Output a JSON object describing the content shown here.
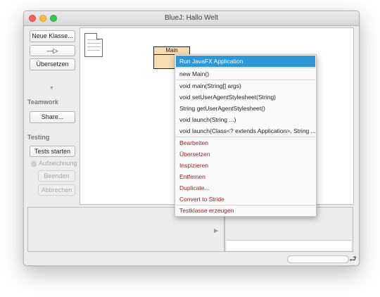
{
  "window": {
    "title": "BlueJ:  Hallo Welt"
  },
  "sidebar": {
    "new_class_label": "Neue Klasse...",
    "arrow_glyph": "—▷",
    "compile_label": "Übersetzen",
    "teamwork_label": "Teamwork",
    "share_label": "Share...",
    "testing_label": "Testing",
    "run_tests_label": "Tests starten",
    "record_label": "Aufzeichnung",
    "end_label": "Beenden",
    "cancel_label": "Abbrechen",
    "collapse_glyph": "▼"
  },
  "class_diagram": {
    "class_name": "Main"
  },
  "context_menu": {
    "items": [
      "Run JavaFX Application",
      "new Main()",
      "void main(String[] args)",
      "void setUserAgentStylesheet(String)",
      "String getUserAgentStylesheet()",
      "void launch(String ...)",
      "void launch(Class<? extends Application>, String ...)",
      "Bearbeiten",
      "Übersetzen",
      "Inspizieren",
      "Entfernen",
      "Duplicate...",
      "Convert to Stride",
      "Testklasse erzeugen"
    ],
    "selected_index": 0
  },
  "colors": {
    "selection": "#2e97d6",
    "class_fill": "#f6dbb3",
    "menu_red": "#a02020",
    "close": "#fc605c",
    "minimize": "#fdbc40",
    "maximize": "#34c84a"
  },
  "icons": {
    "object_bench_arrow": "triangle-right",
    "status_wrap": "return-arrow"
  }
}
